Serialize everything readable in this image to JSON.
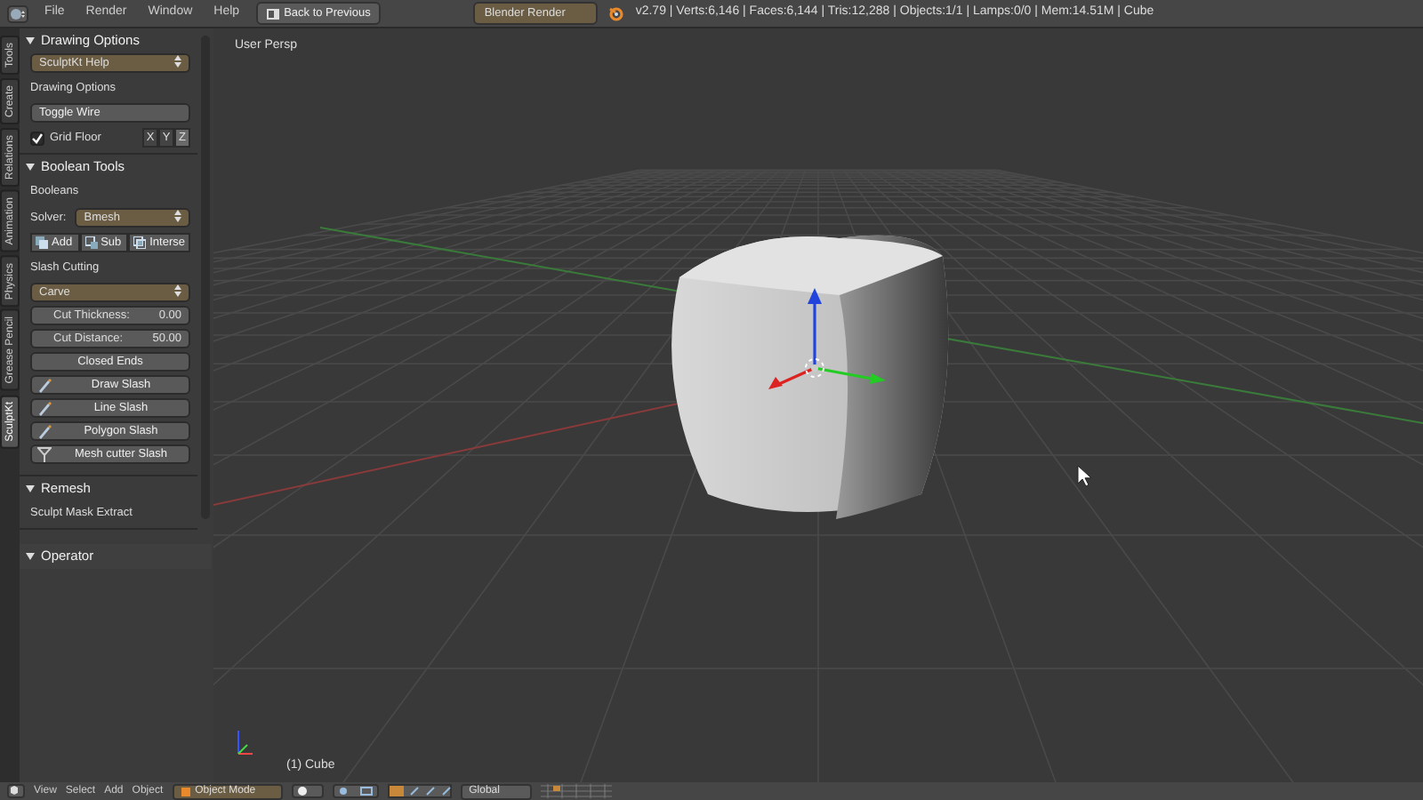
{
  "header": {
    "menus": [
      "File",
      "Render",
      "Window",
      "Help"
    ],
    "back_button": "Back to Previous",
    "render_engine": "Blender Render",
    "stats": "v2.79 | Verts:6,146 | Faces:6,144 | Tris:12,288 | Objects:1/1 | Lamps:0/0 | Mem:14.51M | Cube"
  },
  "tool_tabs": [
    {
      "label": "Tools",
      "selected": false
    },
    {
      "label": "Create",
      "selected": false
    },
    {
      "label": "Relations",
      "selected": false
    },
    {
      "label": "Animation",
      "selected": false
    },
    {
      "label": "Physics",
      "selected": false
    },
    {
      "label": "Grease Pencil",
      "selected": false
    },
    {
      "label": "SculptKt",
      "selected": true
    }
  ],
  "panels": [
    {
      "title": "Drawing Options",
      "expanded": true,
      "items": [
        {
          "kind": "dropdown",
          "value": "SculptKt Help"
        },
        {
          "kind": "label",
          "text": "Drawing Options"
        },
        {
          "kind": "button",
          "label": "Toggle Wire"
        },
        {
          "kind": "checkbox",
          "label": "Grid Floor",
          "checked": true,
          "toggles": [
            {
              "label": "X",
              "selected": false
            },
            {
              "label": "Y",
              "selected": false
            },
            {
              "label": "Z",
              "selected": true
            }
          ]
        }
      ]
    },
    {
      "title": "Boolean Tools",
      "expanded": true,
      "items": [
        {
          "kind": "label",
          "text": "Booleans"
        },
        {
          "kind": "select",
          "label": "Solver:",
          "value": "Bmesh"
        },
        {
          "kind": "button_row",
          "buttons": [
            "Add",
            "Sub",
            "Interse"
          ]
        },
        {
          "kind": "label",
          "text": "Slash Cutting"
        },
        {
          "kind": "dropdown",
          "value": "Carve"
        },
        {
          "kind": "number",
          "label": "Cut Thickness:",
          "value": "0.00"
        },
        {
          "kind": "number",
          "label": "Cut Distance:",
          "value": "50.00"
        },
        {
          "kind": "button",
          "label": "Closed Ends"
        },
        {
          "kind": "tool",
          "label": "Draw Slash"
        },
        {
          "kind": "tool",
          "label": "Line Slash"
        },
        {
          "kind": "tool",
          "label": "Polygon Slash"
        },
        {
          "kind": "tool",
          "label": "Mesh cutter Slash"
        }
      ]
    },
    {
      "title": "Remesh",
      "expanded": true,
      "items": [
        {
          "kind": "label",
          "text": "Sculpt Mask Extract"
        }
      ]
    }
  ],
  "operator_panel": {
    "title": "Operator",
    "expanded": true
  },
  "viewport": {
    "view_label": "User Persp",
    "object_label": "(1) Cube"
  },
  "footer": {
    "menus": [
      "View",
      "Select",
      "Add",
      "Object"
    ],
    "mode": "Object Mode",
    "orientation": "Global"
  }
}
